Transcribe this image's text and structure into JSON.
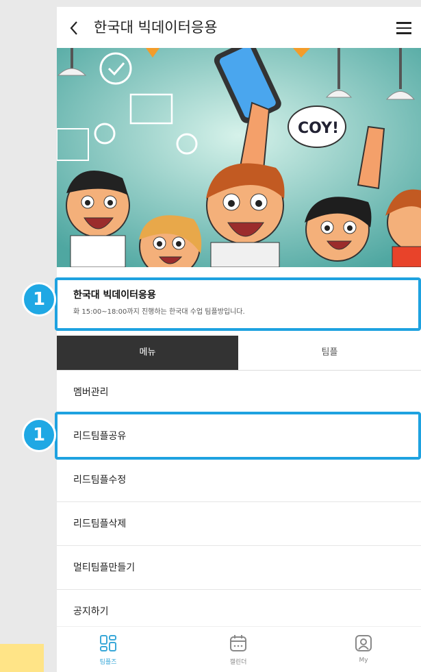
{
  "app": {
    "title": "한국대 빅데이터응용",
    "back_icon": "chevron-left-icon",
    "menu_icon": "hamburger-menu-icon"
  },
  "hero": {
    "speech_bubble": "COY!"
  },
  "room": {
    "name": "한국대 빅데이터응용",
    "description": "화 15:00~18:00까지 진행하는 한국대 수업 팀플방입니다."
  },
  "tabs": [
    {
      "label": "메뉴",
      "active": true
    },
    {
      "label": "팀플",
      "active": false
    }
  ],
  "menu_items": [
    {
      "label": "멤버관리"
    },
    {
      "label": "리드팀플공유"
    },
    {
      "label": "리드팀플수정"
    },
    {
      "label": "리드팀플삭제"
    },
    {
      "label": "멀티팀플만들기"
    },
    {
      "label": "공지하기"
    }
  ],
  "bottom_nav": [
    {
      "label": "팀플즈",
      "icon": "grid-icon",
      "active": true
    },
    {
      "label": "캘린더",
      "icon": "calendar-icon",
      "active": false
    },
    {
      "label": "My",
      "icon": "profile-icon",
      "active": false
    }
  ],
  "annotations": {
    "badge_1": "1",
    "badge_2": "1"
  },
  "colors": {
    "highlight": "#1ea2e0",
    "active_tab": "#333333",
    "nav_active": "#3aa8d8"
  }
}
